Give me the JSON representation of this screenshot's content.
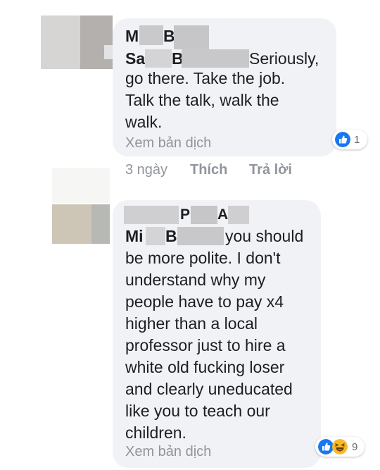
{
  "comments": [
    {
      "name_visible": [
        "M",
        "B"
      ],
      "mention_visible": [
        "Sa",
        "B",
        "Seriously,"
      ],
      "lines": [
        "go there. Take the job.",
        "Talk the talk, walk the",
        "walk."
      ],
      "translate_label": "Xem bản dịch",
      "reactions": {
        "count": "1",
        "icons": [
          "like-icon"
        ]
      }
    },
    {
      "name_visible": [
        "P",
        "A"
      ],
      "mention_visible": [
        "Mi",
        "B",
        "you should"
      ],
      "lines": [
        "be more polite. I don't",
        "understand why my",
        "people have to pay x4",
        "higher than a local",
        "professor just to hire a",
        "white old fucking loser",
        "and clearly uneducated",
        "like you to teach our",
        "children."
      ],
      "translate_label": "Xem bản dịch",
      "reactions": {
        "count": "9",
        "icons": [
          "like-icon",
          "haha-icon"
        ]
      }
    }
  ],
  "actions": {
    "time": "3 ngày",
    "like": "Thích",
    "reply": "Trả lời"
  },
  "colors": {
    "bubble": "#f0f2f5",
    "like_blue": "#1877f2",
    "haha_yellow": "#f7b928",
    "muted": "#90949c"
  }
}
